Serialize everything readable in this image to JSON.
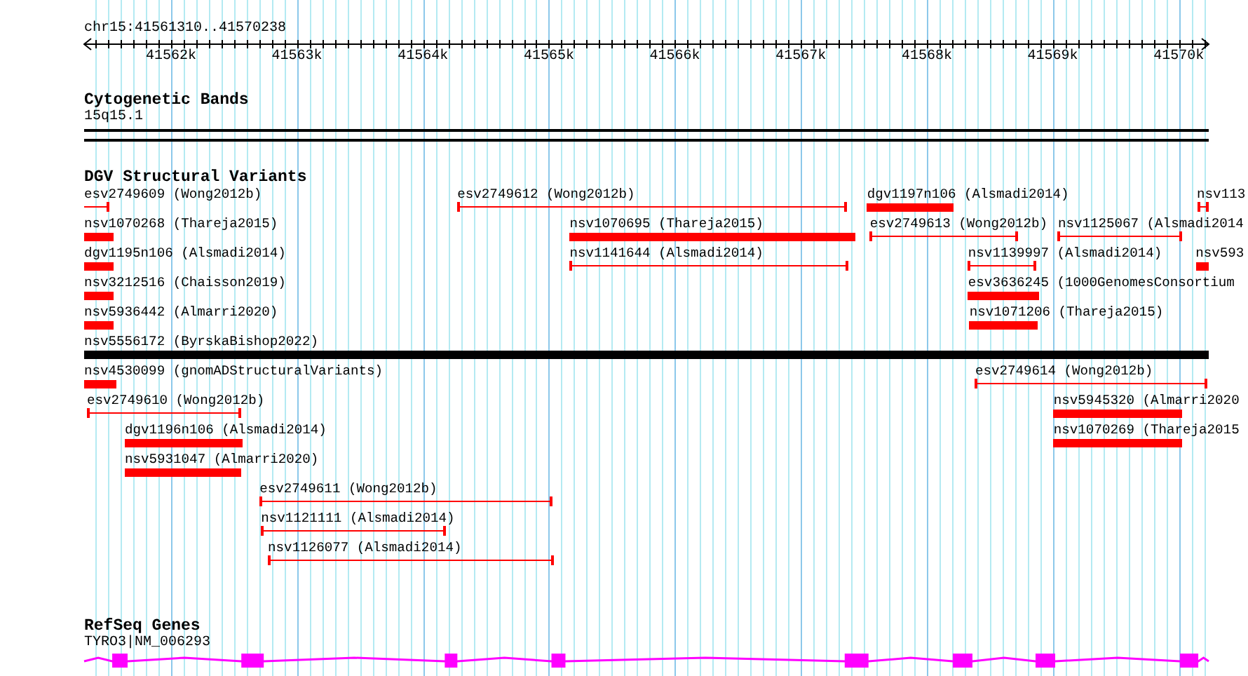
{
  "ruler": {
    "location": "chr15:41561310..41570238",
    "ticks": [
      "41562k",
      "41563k",
      "41564k",
      "41565k",
      "41566k",
      "41567k",
      "41568k",
      "41569k",
      "41570k"
    ]
  },
  "tracks": [
    {
      "kind": "bands",
      "title": "Cytogenetic Bands",
      "features": [
        {
          "label": "15q15.1"
        }
      ]
    },
    {
      "kind": "variants",
      "title": "DGV Structural Variants",
      "lanes": [
        [
          {
            "label": "esv2749609 (Wong2012b)",
            "kind": "span",
            "color": "#ff0000"
          },
          {
            "label": "esv2749612 (Wong2012b)",
            "kind": "span",
            "color": "#ff0000"
          },
          {
            "label": "dgv1197n106 (Alsmadi2014)",
            "kind": "bar",
            "color": "#ff0000"
          },
          {
            "label": "nsv113",
            "kind": "span",
            "color": "#ff0000"
          }
        ],
        [
          {
            "label": "nsv1070268 (Thareja2015)",
            "kind": "bar",
            "color": "#ff0000"
          },
          {
            "label": "nsv1070695 (Thareja2015)",
            "kind": "bar",
            "color": "#ff0000"
          },
          {
            "label": "esv2749613 (Wong2012b)",
            "kind": "span",
            "color": "#ff0000"
          },
          {
            "label": "nsv1125067 (Alsmadi2014",
            "kind": "span",
            "color": "#ff0000"
          }
        ],
        [
          {
            "label": "dgv1195n106 (Alsmadi2014)",
            "kind": "bar",
            "color": "#ff0000"
          },
          {
            "label": "nsv1141644 (Alsmadi2014)",
            "kind": "span",
            "color": "#ff0000"
          },
          {
            "label": "nsv1139997 (Alsmadi2014)",
            "kind": "span",
            "color": "#ff0000"
          },
          {
            "label": "nsv593",
            "kind": "bar",
            "color": "#ff0000"
          }
        ],
        [
          {
            "label": "nsv3212516 (Chaisson2019)",
            "kind": "bar",
            "color": "#ff0000"
          },
          {
            "label": "esv3636245 (1000GenomesConsortium",
            "kind": "bar",
            "color": "#ff0000"
          }
        ],
        [
          {
            "label": "nsv5936442 (Almarri2020)",
            "kind": "bar",
            "color": "#ff0000"
          },
          {
            "label": "nsv1071206 (Thareja2015)",
            "kind": "bar",
            "color": "#ff0000"
          }
        ],
        [
          {
            "label": "nsv5556172 (ByrskaBishop2022)",
            "kind": "bar",
            "color": "#000000"
          }
        ],
        [
          {
            "label": "nsv4530099 (gnomADStructuralVariants)",
            "kind": "bar",
            "color": "#ff0000"
          },
          {
            "label": "esv2749614 (Wong2012b)",
            "kind": "span",
            "color": "#ff0000"
          }
        ],
        [
          {
            "label": "esv2749610 (Wong2012b)",
            "kind": "span",
            "color": "#ff0000"
          },
          {
            "label": "nsv5945320 (Almarri2020",
            "kind": "bar",
            "color": "#ff0000"
          }
        ],
        [
          {
            "label": "dgv1196n106 (Alsmadi2014)",
            "kind": "bar",
            "color": "#ff0000"
          },
          {
            "label": "nsv1070269 (Thareja2015",
            "kind": "bar",
            "color": "#ff0000"
          }
        ],
        [
          {
            "label": "nsv5931047 (Almarri2020)",
            "kind": "bar",
            "color": "#ff0000"
          }
        ],
        [
          {
            "label": "esv2749611 (Wong2012b)",
            "kind": "span",
            "color": "#ff0000"
          }
        ],
        [
          {
            "label": "nsv1121111 (Alsmadi2014)",
            "kind": "span",
            "color": "#ff0000"
          }
        ],
        [
          {
            "label": "nsv1126077 (Alsmadi2014)",
            "kind": "span",
            "color": "#ff0000"
          }
        ]
      ]
    },
    {
      "kind": "genes",
      "title": "RefSeq Genes",
      "genes": [
        {
          "label": "TYRO3|NM_006293"
        }
      ]
    }
  ]
}
